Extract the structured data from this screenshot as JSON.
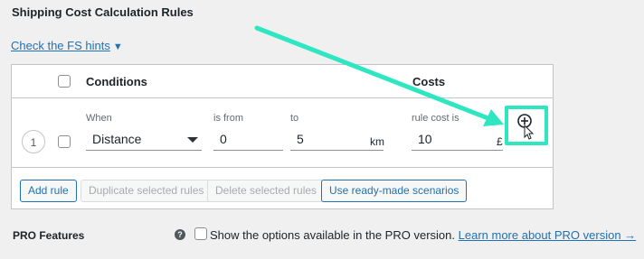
{
  "section": {
    "title": "Shipping Cost Calculation Rules",
    "hints_link": "Check the FS hints",
    "hints_caret": "▼"
  },
  "table": {
    "headers": {
      "conditions": "Conditions",
      "costs": "Costs"
    },
    "row": {
      "index": "1",
      "labels": {
        "when": "When",
        "is_from": "is from",
        "to": "to",
        "rule_cost": "rule cost is"
      },
      "condition_value": "Distance",
      "from_value": "0",
      "to_value": "5",
      "to_unit": "km",
      "cost_value": "10",
      "cost_currency": "£"
    }
  },
  "buttons": {
    "add_rule": "Add rule",
    "duplicate": "Duplicate selected rules",
    "delete": "Delete selected rules",
    "scenarios": "Use ready-made scenarios"
  },
  "pro": {
    "title": "PRO Features",
    "help": "?",
    "checkbox_label": "Show the options available in the PRO version.",
    "learn_more": "Learn more about PRO version →"
  },
  "colors": {
    "accent_highlight": "#2ee6c0",
    "link": "#2271b1"
  }
}
